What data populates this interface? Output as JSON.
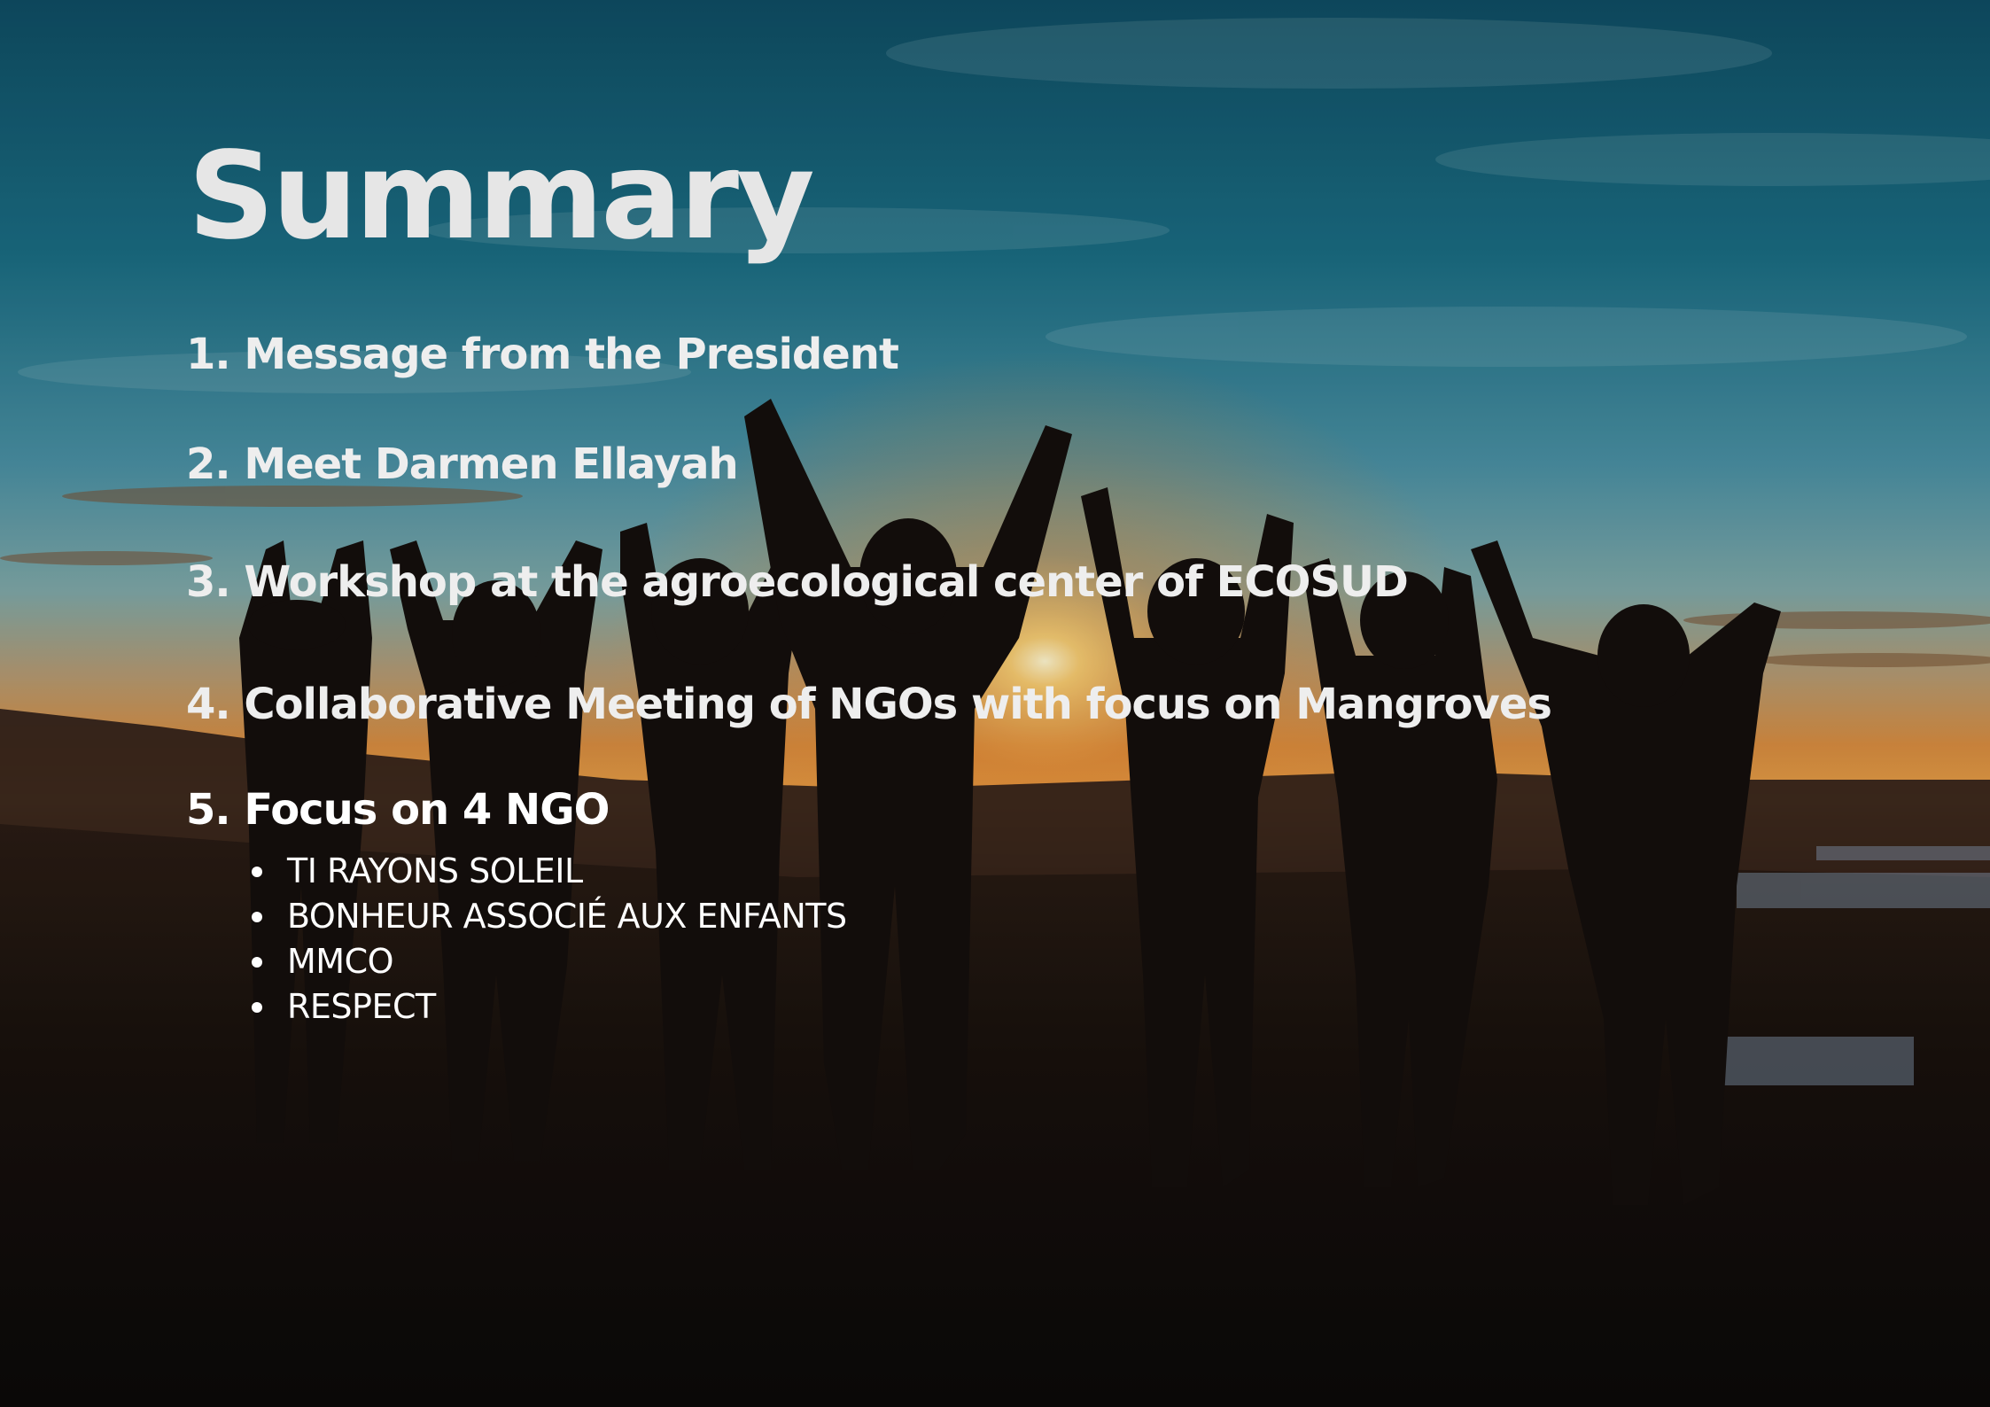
{
  "title": "Summary",
  "items": [
    {
      "label": "1. Message from the President"
    },
    {
      "label": "2. Meet Darmen Ellayah"
    },
    {
      "label": "3. Workshop at the agroecological center of ECOSUD"
    },
    {
      "label": "4. Collaborative Meeting of NGOs with focus on Mangroves"
    },
    {
      "label": "5. Focus on 4 NGO"
    }
  ],
  "ngos": [
    "TI RAYONS SOLEIL",
    "BONHEUR ASSOCIÉ AUX ENFANTS",
    "MMCO",
    "RESPECT"
  ],
  "background": {
    "description_icon": "sunset-silhouette-group-photo",
    "sky_top_color": "#15576e",
    "sky_horizon_color": "#e8a048",
    "sun_color": "#ffe8a0",
    "ground_color": "#120e0c"
  }
}
